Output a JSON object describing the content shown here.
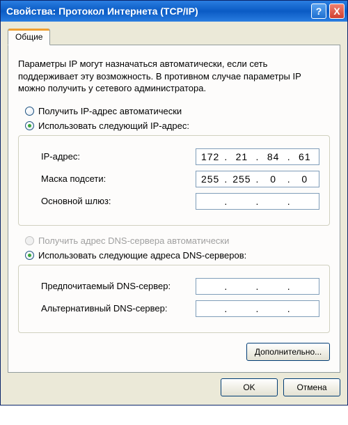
{
  "window": {
    "title": "Свойства: Протокол Интернета (TCP/IP)",
    "help": "?",
    "close": "X"
  },
  "tabs": {
    "general": "Общие"
  },
  "description": "Параметры IP могут назначаться автоматически, если сеть поддерживает эту возможность. В противном случае параметры IP можно получить у сетевого администратора.",
  "ip_group": {
    "radio_auto": "Получить IP-адрес автоматически",
    "radio_manual": "Использовать следующий IP-адрес:",
    "ip_label": "IP-адрес:",
    "ip_value": [
      "172",
      "21",
      "84",
      "61"
    ],
    "mask_label": "Маска подсети:",
    "mask_value": [
      "255",
      "255",
      "0",
      "0"
    ],
    "gateway_label": "Основной шлюз:",
    "gateway_value": [
      "",
      "",
      "",
      ""
    ]
  },
  "dns_group": {
    "radio_auto": "Получить адрес DNS-сервера автоматически",
    "radio_manual": "Использовать следующие адреса DNS-серверов:",
    "pref_label": "Предпочитаемый DNS-сервер:",
    "pref_value": [
      "",
      "",
      "",
      ""
    ],
    "alt_label": "Альтернативный DNS-сервер:",
    "alt_value": [
      "",
      "",
      "",
      ""
    ]
  },
  "buttons": {
    "advanced": "Дополнительно...",
    "ok": "OK",
    "cancel": "Отмена"
  }
}
